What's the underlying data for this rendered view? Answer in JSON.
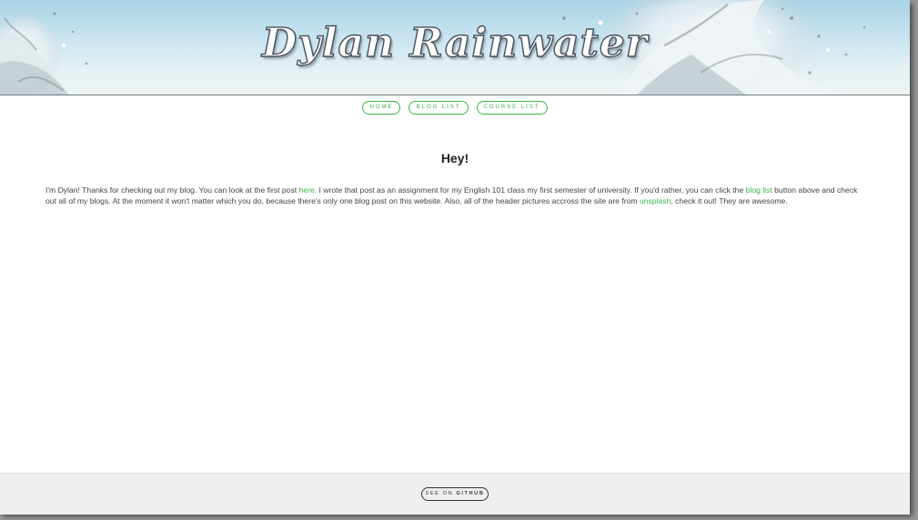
{
  "header": {
    "site_title": "Dylan Rainwater"
  },
  "nav": {
    "items": [
      {
        "label": "HOME"
      },
      {
        "label": "BLOG LIST"
      },
      {
        "label": "COURSE LIST"
      }
    ]
  },
  "main": {
    "heading": "Hey!",
    "paragraph": {
      "part1": "I'm Dylan! Thanks for checking out my blog. You can look at the first post ",
      "link_here": "here",
      "part2": ". I wrote that post as an assignment for my English 101 class my first semester of university. If you'd rather, you can click the ",
      "link_blog_list": "blog list",
      "part3": " button above and check out all of my blogs. At the moment it won't matter which you do, because there's only one blog post on this website. Also, all of the header pictures accross the site are from ",
      "link_unsplash": "unsplash",
      "part4": ", check it out! They are awesome."
    }
  },
  "footer": {
    "github_prefix": "SEE ON ",
    "github_bold": "GITHUB"
  },
  "colors": {
    "accent_green": "#39b54a",
    "footer_bg": "#efefef",
    "header_sky": "#c9e4f0"
  }
}
